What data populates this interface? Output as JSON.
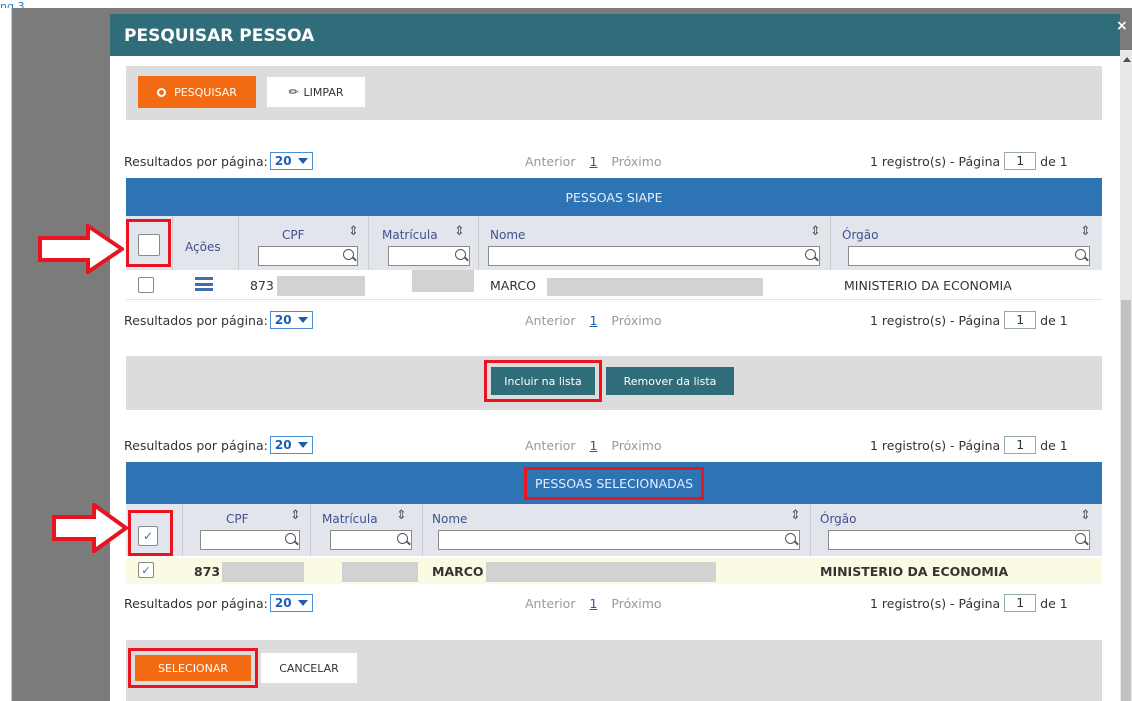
{
  "corner_text": "ng 3",
  "modal": {
    "title": "PESQUISAR PESSOA",
    "close": "×"
  },
  "toolbar": {
    "search_label": "PESQUISAR",
    "clear_label": "LIMPAR"
  },
  "pager": {
    "results_label": "Resultados por página:",
    "per_page": "20",
    "prev": "Anterior",
    "page_link": "1",
    "next": "Próximo",
    "records_label": "1 registro(s) - Página",
    "current_page": "1",
    "of_label": "de 1"
  },
  "siape": {
    "title": "PESSOAS SIAPE",
    "columns": {
      "actions": "Ações",
      "cpf": "CPF",
      "matricula": "Matrícula",
      "nome": "Nome",
      "orgao": "Órgão"
    },
    "row": {
      "cpf": "873",
      "nome": "MARCO",
      "orgao": "MINISTERIO DA ECONOMIA"
    }
  },
  "list_actions": {
    "include": "Incluir na lista",
    "remove": "Remover da lista"
  },
  "selected": {
    "title": "PESSOAS SELECIONADAS",
    "columns": {
      "cpf": "CPF",
      "matricula": "Matrícula",
      "nome": "Nome",
      "orgao": "Órgão"
    },
    "row": {
      "cpf": "873",
      "nome": "MARCO",
      "orgao": "MINISTERIO DA ECONOMIA"
    }
  },
  "footer": {
    "select_label": "SELECIONAR",
    "cancel_label": "CANCELAR"
  },
  "colors": {
    "header_teal": "#2f6d7a",
    "table_blue": "#2e73b4",
    "accent_orange": "#f26a12",
    "highlight_red": "#e8141f",
    "selected_row": "#fbfbe4"
  }
}
